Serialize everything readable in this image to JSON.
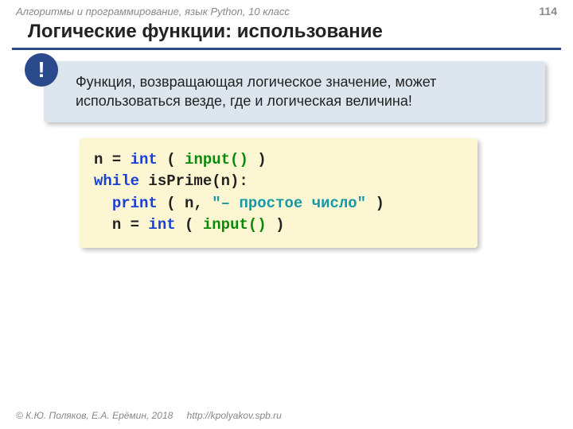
{
  "header": {
    "course": "Алгоритмы и программирование, язык Python, 10 класс",
    "page": "114"
  },
  "title": "Логические функции: использование",
  "callout": {
    "bang": "!",
    "text": "Функция, возвращающая логическое значение, может использоваться везде, где и логическая величина!"
  },
  "code": {
    "l1_a": "n = ",
    "l1_int": "int",
    "l1_b": " ( ",
    "l1_input": "input()",
    "l1_c": " )",
    "l2_while": "while",
    "l2_a": " isPrime(n):",
    "l3_pad": "  ",
    "l3_print": "print",
    "l3_a": " ( n, ",
    "l3_str": "\"– простое число\"",
    "l3_b": " )",
    "l4_pad": "  ",
    "l4_a": "n = ",
    "l4_int": "int",
    "l4_b": " ( ",
    "l4_input": "input()",
    "l4_c": " )"
  },
  "footer": {
    "copyright": "© К.Ю. Поляков, Е.А. Ерёмин, 2018",
    "url": "http://kpolyakov.spb.ru"
  }
}
